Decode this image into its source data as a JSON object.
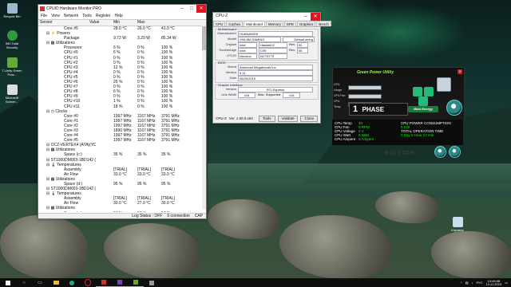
{
  "desktop": {
    "icons": [
      {
        "label": "Recycle Bin",
        "name": "recycle-bin-icon"
      },
      {
        "label": "360 Total Security",
        "name": "shield-icon"
      },
      {
        "label": "T-Unity Green Pow...",
        "name": "app-icon"
      },
      {
        "label": "Microsoft Screen...",
        "name": "screen-icon"
      }
    ],
    "right_icon_label": "Корзина"
  },
  "hwmonitor": {
    "title": "CPUID Hardware Monitor PRO",
    "menu": [
      "File",
      "View",
      "Network",
      "Tools",
      "Register",
      "Help"
    ],
    "headers": [
      "Sensor",
      "Value",
      "Min",
      "Max"
    ],
    "rows": [
      [
        "Core #5",
        "28.0 °C",
        "26.0 °C",
        "41.0 °C"
      ],
      [
        "⊟ ⚡ Powers",
        "",
        "",
        ""
      ],
      [
        "Package",
        "9.72 W",
        "3.20 W",
        "85.34 W"
      ],
      [
        "⊟ ▦ Utilizations",
        "",
        "",
        ""
      ],
      [
        "Processor",
        "6 %",
        "0 %",
        "100 %"
      ],
      [
        "CPU #0",
        "6 %",
        "0 %",
        "100 %"
      ],
      [
        "CPU #1",
        "0 %",
        "0 %",
        "100 %"
      ],
      [
        "CPU #2",
        "0 %",
        "0 %",
        "100 %"
      ],
      [
        "CPU #3",
        "12 %",
        "0 %",
        "100 %"
      ],
      [
        "CPU #4",
        "0 %",
        "0 %",
        "100 %"
      ],
      [
        "CPU #5",
        "0 %",
        "0 %",
        "100 %"
      ],
      [
        "CPU #6",
        "26 %",
        "0 %",
        "100 %"
      ],
      [
        "CPU #7",
        "0 %",
        "0 %",
        "100 %"
      ],
      [
        "CPU #8",
        "6 %",
        "0 %",
        "100 %"
      ],
      [
        "CPU #9",
        "0 %",
        "0 %",
        "100 %"
      ],
      [
        "CPU #10",
        "1 %",
        "0 %",
        "100 %"
      ],
      [
        "CPU #11",
        "18 %",
        "0 %",
        "100 %"
      ],
      [
        "⊟ ◷ Clocks",
        "",
        "",
        ""
      ],
      [
        "Core #0",
        "1997 MHz",
        "1167 MHz",
        "3791 MHz"
      ],
      [
        "Core #1",
        "1997 MHz",
        "1167 MHz",
        "3791 MHz"
      ],
      [
        "Core #2",
        "1997 MHz",
        "1167 MHz",
        "3791 MHz"
      ],
      [
        "Core #3",
        "1890 MHz",
        "1167 MHz",
        "3791 MHz"
      ],
      [
        "Core #4",
        "1997 MHz",
        "1167 MHz",
        "3791 MHz"
      ],
      [
        "Core #5",
        "1997 MHz",
        "1167 MHz",
        "3791 MHz"
      ],
      [
        "⊟ OCZ-VERTEX4 (ATA)(YD...",
        "",
        "",
        ""
      ],
      [
        "⊟ ▦ Utilizations",
        "",
        "",
        ""
      ],
      [
        "Space (c:)",
        "35 %",
        "35 %",
        "35 %"
      ],
      [
        "⊟ ST1000DM003-1BD142 (...",
        "",
        "",
        ""
      ],
      [
        "⊟ 🌡 Temperatures",
        "",
        "",
        ""
      ],
      [
        "Assembly",
        "[TRIAL]",
        "[TRIAL]",
        "[TRIAL]"
      ],
      [
        "Air Flow",
        "33.0 °C",
        "33.0 °C",
        "33.0 °C"
      ],
      [
        "⊟ ▦ Utilizations",
        "",
        "",
        ""
      ],
      [
        "Space (d:)",
        "95 %",
        "95 %",
        "95 %"
      ],
      [
        "⊟ ST1000DM003-1BD142 (...",
        "",
        "",
        ""
      ],
      [
        "⊟ 🌡 Temperatures",
        "",
        "",
        ""
      ],
      [
        "Assembly",
        "[TRIAL]",
        "[TRIAL]",
        "[TRIAL]"
      ],
      [
        "Air Flow",
        "30.0 °C",
        "27.0 °C",
        "30.0 °C"
      ],
      [
        "⊟ ▦ Utilizations",
        "",
        "",
        ""
      ],
      [
        "Space (e:)",
        "84 %",
        "84 %",
        "84 %"
      ]
    ],
    "status": [
      "Log Status : OFF",
      "0 connection",
      "CAP"
    ]
  },
  "cpuz": {
    "title": "CPU-Z",
    "tabs": [
      "CPU",
      "Caches",
      "Mainboard",
      "Memory",
      "SPD",
      "Graphics",
      "Bench"
    ],
    "motherboard_label": "Motherboard",
    "manufacturer": {
      "label": "Manufacturer",
      "value": "HUANANZHI"
    },
    "model": {
      "label": "Model",
      "value": "X99-8M GAMING",
      "extra": "Default string"
    },
    "chipset": {
      "label": "Chipset",
      "vendor": "Intel",
      "value": "Haswell-E",
      "rev_label": "Rev.",
      "rev": "02"
    },
    "southbridge": {
      "label": "Southbridge",
      "vendor": "Intel",
      "value": "C99",
      "rev_label": "Rev.",
      "rev": "05"
    },
    "lpcio": {
      "label": "LPCIO",
      "vendor": "Nuvoton",
      "value": "NCT6779"
    },
    "bios_label": "BIOS",
    "bios_brand": {
      "label": "Brand",
      "value": "American Megatrends Inc."
    },
    "bios_version": {
      "label": "Version",
      "value": "5.11"
    },
    "bios_date": {
      "label": "Date",
      "value": "06/20/2019"
    },
    "gi_label": "Graphic Interface",
    "gi_version": {
      "label": "Version",
      "value": "PCI-Express"
    },
    "gi_link": {
      "label": "Link Width",
      "value": "x16",
      "max_label": "Max. Supported",
      "max": "x16"
    },
    "footer": {
      "brand": "CPU-Z",
      "ver": "Ver. 1.90.0.x64",
      "tools": "Tools",
      "validate": "Validate",
      "close": "Close"
    }
  },
  "gpu_utility": {
    "title": "Green Power Utility",
    "fields": [
      "CPU Usage",
      "CPU Fan",
      "CPU Temp"
    ],
    "phase_num": "1",
    "phase": "PHASE",
    "mode": "Maxi-Energy"
  },
  "info": {
    "left": [
      {
        "k": "CPU Temp",
        "v": "40"
      },
      {
        "k": "CPU Fan",
        "v": "0 RPM"
      },
      {
        "k": "CPU Voltage",
        "v": "0 V"
      },
      {
        "k": "CPU Watt",
        "v": "0 Watt"
      },
      {
        "k": "CPU Ampere",
        "v": "0 Ampere"
      }
    ],
    "r1_label": "CPU POWER CONSUMPTION",
    "r1_value": "0 KW",
    "r2_label": "TOTAL OPERATION TIME",
    "r2_value": "0 Day 0 Hour 17 min",
    "brand": "BIGSTAR"
  },
  "taskbar": {
    "lang": "РУС",
    "time": "13:45:58",
    "date": "14.11.2019"
  },
  "colors": {
    "accent": "#e81123",
    "lcd_green": "#00ff00",
    "taskbar": "#0e0e10"
  }
}
